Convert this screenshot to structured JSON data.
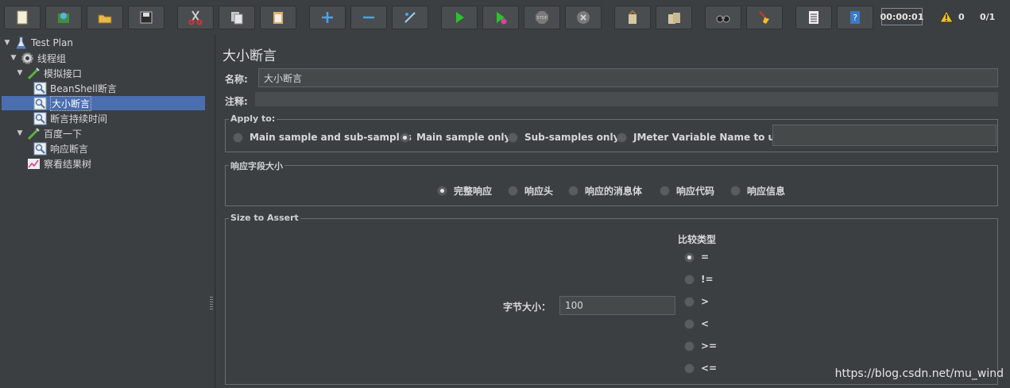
{
  "toolbar": {
    "buttons": [
      "new-icon",
      "templates-icon",
      "open-icon",
      "save-icon",
      "cut-icon",
      "copy-icon",
      "paste-icon",
      "expand-icon",
      "collapse-icon",
      "toggle-icon",
      "start-icon",
      "start-no-pause-icon",
      "stop-icon",
      "shutdown-icon",
      "clear-icon",
      "clear-all-icon",
      "search-icon",
      "reset-search-icon",
      "function-helper-icon",
      "help-icon"
    ],
    "timer": "00:00:01",
    "warnings": "0",
    "threads": "0/1"
  },
  "tree": {
    "items": [
      {
        "label": "Test Plan",
        "icon": "test-plan-icon"
      },
      {
        "label": "线程组",
        "icon": "gear-icon"
      },
      {
        "label": "模拟接口",
        "icon": "sampler-icon"
      },
      {
        "label": "BeanShell断言",
        "icon": "assertion-icon"
      },
      {
        "label": "大小断言",
        "icon": "assertion-icon"
      },
      {
        "label": "断言持续时间",
        "icon": "assertion-icon"
      },
      {
        "label": "百度一下",
        "icon": "sampler-icon"
      },
      {
        "label": "响应断言",
        "icon": "assertion-icon"
      },
      {
        "label": "察看结果树",
        "icon": "listener-icon"
      }
    ]
  },
  "panel": {
    "title": "大小断言",
    "name_label": "名称:",
    "name_value": "大小断言",
    "comment_label": "注释:",
    "comment_value": "",
    "apply_to": {
      "title": "Apply to:",
      "options": [
        "Main sample and sub-samples",
        "Main sample only",
        "Sub-samples only",
        "JMeter Variable Name to use"
      ],
      "selected": 1,
      "variable_value": ""
    },
    "response_field": {
      "title": "响应字段大小",
      "options": [
        "完整响应",
        "响应头",
        "响应的消息体",
        "响应代码",
        "响应信息"
      ],
      "selected": 0
    },
    "size_to_assert": {
      "title": "Size to Assert",
      "size_label": "字节大小：",
      "size_value": "100",
      "compare_label": "比较类型",
      "operators": [
        "=",
        "!=",
        ">",
        "<",
        ">=",
        "<="
      ],
      "selected": 0
    }
  },
  "watermark": "https://blog.csdn.net/mu_wind",
  "colors": {
    "background": "#3c3f41",
    "selection": "#4b6eaf"
  }
}
